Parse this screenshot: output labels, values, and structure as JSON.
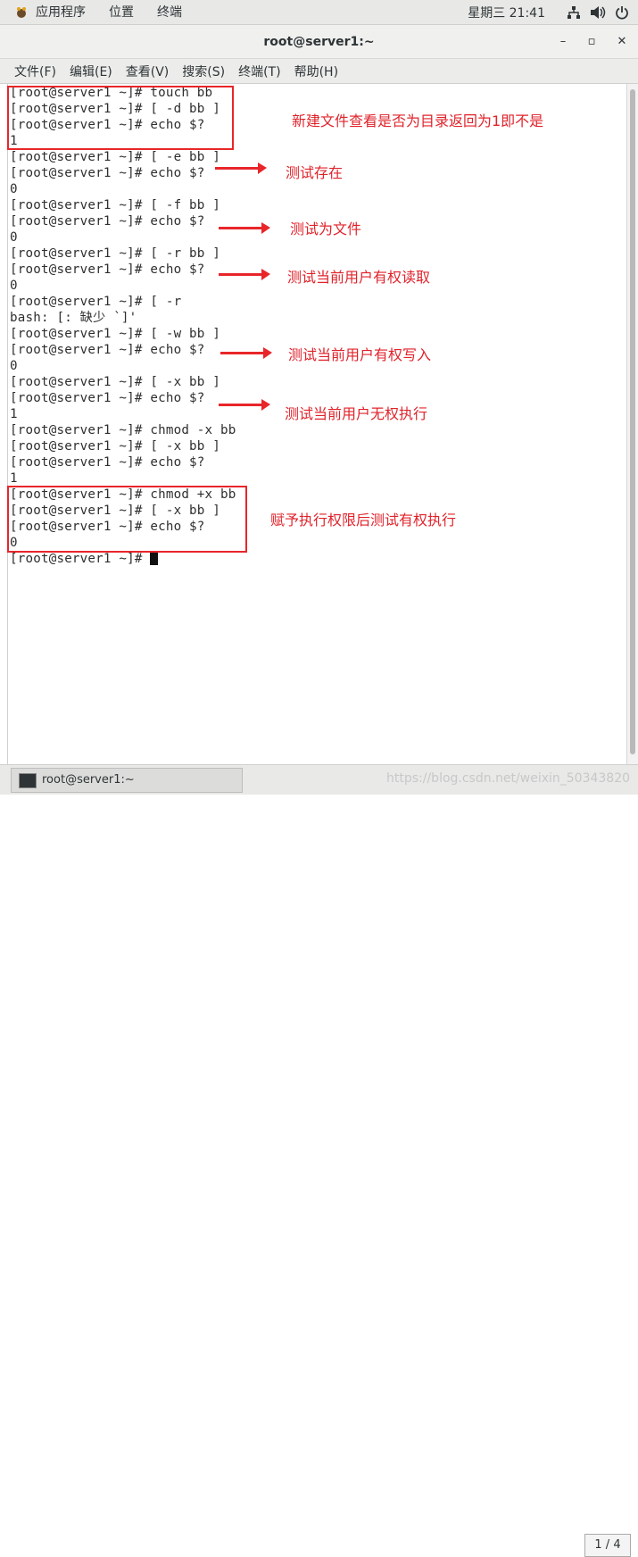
{
  "top_panel": {
    "applications": "应用程序",
    "places": "位置",
    "terminal": "终端",
    "clock": "星期三 21:41",
    "network_icon": "network-icon",
    "volume_icon": "volume-icon",
    "power_icon": "power-icon"
  },
  "window": {
    "title": "root@server1:~",
    "minimize": "–",
    "maximize": "▫",
    "close": "✕"
  },
  "menu": {
    "file": "文件(F)",
    "edit": "编辑(E)",
    "view": "查看(V)",
    "search": "搜索(S)",
    "terminal": "终端(T)",
    "help": "帮助(H)"
  },
  "terminal_lines": [
    "[root@server1 ~]# touch bb",
    "[root@server1 ~]# [ -d bb ]",
    "[root@server1 ~]# echo $?",
    "1",
    "[root@server1 ~]# [ -e bb ]",
    "[root@server1 ~]# echo $?",
    "0",
    "[root@server1 ~]# [ -f bb ]",
    "[root@server1 ~]# echo $?",
    "0",
    "[root@server1 ~]# [ -r bb ]",
    "[root@server1 ~]# echo $?",
    "0",
    "[root@server1 ~]# [ -r",
    "bash: [: 缺少 `]'",
    "[root@server1 ~]# [ -w bb ]",
    "[root@server1 ~]# echo $?",
    "0",
    "[root@server1 ~]# [ -x bb ]",
    "[root@server1 ~]# echo $?",
    "1",
    "[root@server1 ~]# chmod -x bb",
    "[root@server1 ~]# [ -x bb ]",
    "[root@server1 ~]# echo $?",
    "1",
    "[root@server1 ~]# chmod +x bb",
    "[root@server1 ~]# [ -x bb ]",
    "[root@server1 ~]# echo $?",
    "0",
    "[root@server1 ~]# "
  ],
  "annotations": {
    "a1": "新建文件查看是否为目录返回为1即不是",
    "a2": "测试存在",
    "a3": "测试为文件",
    "a4": "测试当前用户有权读取",
    "a5": "测试当前用户有权写入",
    "a6": "测试当前用户无权执行",
    "a7": "赋予执行权限后测试有权执行"
  },
  "taskbar": {
    "item": "root@server1:~",
    "pager": "1 / 4"
  },
  "watermark": "https://blog.csdn.net/weixin_50343820",
  "colors": {
    "annotation_red": "#e8262a",
    "terminal_bg": "#ffffff",
    "panel_bg": "#e8e8e7"
  }
}
